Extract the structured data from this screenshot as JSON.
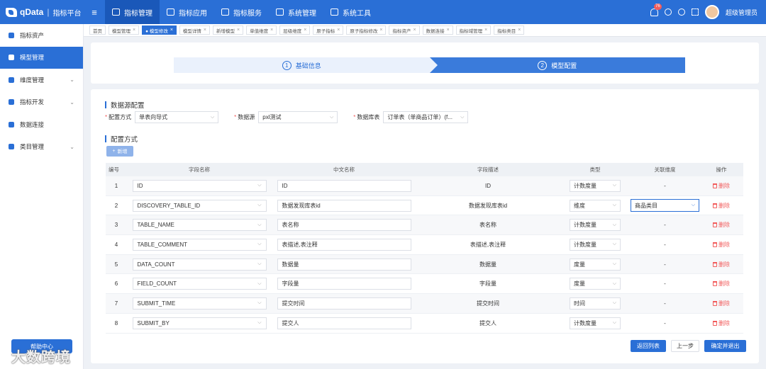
{
  "header": {
    "logo_text": "qData",
    "separator": "|",
    "platform": "指标平台",
    "nav": [
      {
        "label": "指标管理",
        "active": true
      },
      {
        "label": "指标应用",
        "active": false
      },
      {
        "label": "指标服务",
        "active": false
      },
      {
        "label": "系统管理",
        "active": false
      },
      {
        "label": "系统工具",
        "active": false
      }
    ],
    "notification_count": "76",
    "user_name": "超级管理员"
  },
  "sidebar": {
    "items": [
      {
        "label": "指标资产",
        "active": false,
        "has_children": false
      },
      {
        "label": "模型管理",
        "active": true,
        "has_children": false
      },
      {
        "label": "维度管理",
        "active": false,
        "has_children": true
      },
      {
        "label": "指标开发",
        "active": false,
        "has_children": true
      },
      {
        "label": "数据连接",
        "active": false,
        "has_children": false
      },
      {
        "label": "类目管理",
        "active": false,
        "has_children": true
      }
    ],
    "help_label": "帮助中心",
    "watermark": "大数跨境"
  },
  "tabs": [
    {
      "label": "首页",
      "closable": false,
      "active": false
    },
    {
      "label": "模型管理",
      "closable": true,
      "active": false
    },
    {
      "label": "● 模型修改",
      "closable": true,
      "active": true
    },
    {
      "label": "模型详情",
      "closable": true,
      "active": false
    },
    {
      "label": "新增模型",
      "closable": true,
      "active": false
    },
    {
      "label": "单值维度",
      "closable": true,
      "active": false
    },
    {
      "label": "层级维度",
      "closable": true,
      "active": false
    },
    {
      "label": "原子指标",
      "closable": true,
      "active": false
    },
    {
      "label": "原子指标修改",
      "closable": true,
      "active": false
    },
    {
      "label": "指标资产",
      "closable": true,
      "active": false
    },
    {
      "label": "数据连接",
      "closable": true,
      "active": false
    },
    {
      "label": "指标域管理",
      "closable": true,
      "active": false
    },
    {
      "label": "指标类目",
      "closable": true,
      "active": false
    }
  ],
  "steps": [
    {
      "num": "1",
      "label": "基础信息",
      "active": false
    },
    {
      "num": "2",
      "label": "模型配置",
      "active": true
    }
  ],
  "datasource": {
    "title": "数据源配置",
    "config_mode_label": "配置方式",
    "config_mode_value": "单表向导式",
    "datasource_label": "数据源",
    "datasource_value": "pxl测试",
    "table_label": "数据库表",
    "table_value": "订单表（单商品订单）(f..."
  },
  "config": {
    "title": "配置方式",
    "add_label": "新增"
  },
  "table": {
    "headers": [
      "编号",
      "字段名称",
      "中文名称",
      "字段描述",
      "类型",
      "关联维度",
      "操作"
    ],
    "delete_label": "删除",
    "rows": [
      {
        "no": "1",
        "field": "ID",
        "cn": "ID",
        "desc": "ID",
        "type": "计数度量",
        "dim": "-",
        "dim_select": false
      },
      {
        "no": "2",
        "field": "DISCOVERY_TABLE_ID",
        "cn": "数据发现库表id",
        "desc": "数据发现库表id",
        "type": "维度",
        "dim": "商品类目",
        "dim_select": true
      },
      {
        "no": "3",
        "field": "TABLE_NAME",
        "cn": "表名称",
        "desc": "表名称",
        "type": "计数度量",
        "dim": "-",
        "dim_select": false
      },
      {
        "no": "4",
        "field": "TABLE_COMMENT",
        "cn": "表描述,表注释",
        "desc": "表描述,表注释",
        "type": "计数度量",
        "dim": "-",
        "dim_select": false
      },
      {
        "no": "5",
        "field": "DATA_COUNT",
        "cn": "数据量",
        "desc": "数据量",
        "type": "度量",
        "dim": "-",
        "dim_select": false
      },
      {
        "no": "6",
        "field": "FIELD_COUNT",
        "cn": "字段量",
        "desc": "字段量",
        "type": "度量",
        "dim": "-",
        "dim_select": false
      },
      {
        "no": "7",
        "field": "SUBMIT_TIME",
        "cn": "提交时间",
        "desc": "提交时间",
        "type": "时间",
        "dim": "-",
        "dim_select": false
      },
      {
        "no": "8",
        "field": "SUBMIT_BY",
        "cn": "提交人",
        "desc": "提交人",
        "type": "计数度量",
        "dim": "-",
        "dim_select": false
      }
    ]
  },
  "footer": {
    "back_list": "返回列表",
    "prev": "上一步",
    "confirm_exit": "确定并退出"
  },
  "colors": {
    "primary": "#2a6fd6",
    "danger": "#f25c5c"
  }
}
